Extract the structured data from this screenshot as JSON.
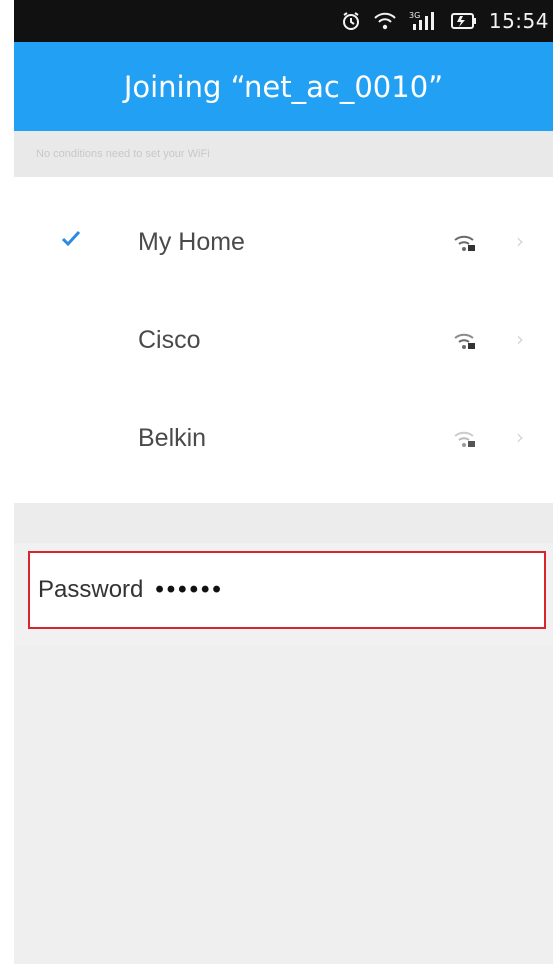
{
  "status_bar": {
    "time": "15:54",
    "network_label": "3G",
    "icons": [
      "alarm-icon",
      "wifi-icon",
      "cellular-signal-icon",
      "battery-icon"
    ]
  },
  "header": {
    "title": "Joining “net_ac_0010”"
  },
  "hint_text": "No conditions need to set your WiFi",
  "networks": [
    {
      "name": "My Home",
      "selected": true
    },
    {
      "name": "Cisco",
      "selected": false
    },
    {
      "name": "Belkin",
      "selected": false
    }
  ],
  "password": {
    "label": "Password",
    "value": "••••••"
  },
  "colors": {
    "accent": "#22a1f4",
    "highlight_border": "#d8242c",
    "check": "#2d8ae0"
  }
}
